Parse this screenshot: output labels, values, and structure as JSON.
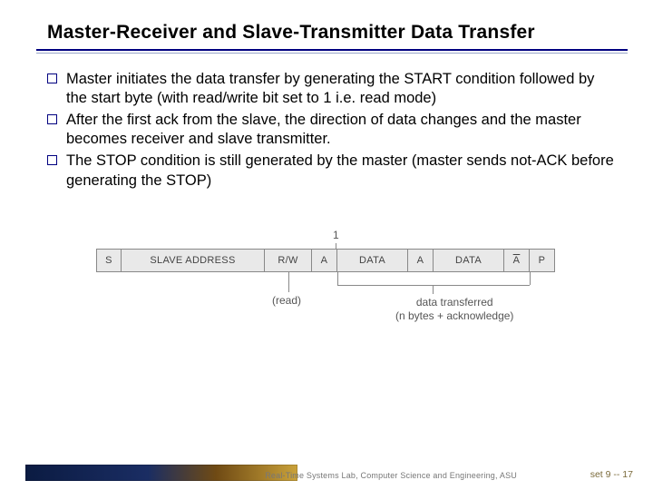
{
  "title": "Master-Receiver and Slave-Transmitter Data Transfer",
  "bullets": [
    "Master initiates the data transfer by generating the START condition followed by the start byte (with read/write  bit set to 1 i.e. read mode)",
    "After the first ack from the slave, the direction of data changes and the master becomes receiver and slave transmitter.",
    "The STOP condition is still generated by the master (master sends not-ACK before generating the STOP)"
  ],
  "diagram": {
    "one": "1",
    "cells": {
      "s": "S",
      "addr": "SLAVE ADDRESS",
      "rw": "R/W",
      "a": "A",
      "data": "DATA",
      "a_bar": "A",
      "p": "P"
    },
    "read_label": "(read)",
    "transfer_label_line1": "data transferred",
    "transfer_label_line2": "(n bytes + acknowledge)"
  },
  "footer": {
    "lab": "Real-Time Systems Lab, Computer Science and Engineering, ASU",
    "page": "set 9 -- 17"
  }
}
